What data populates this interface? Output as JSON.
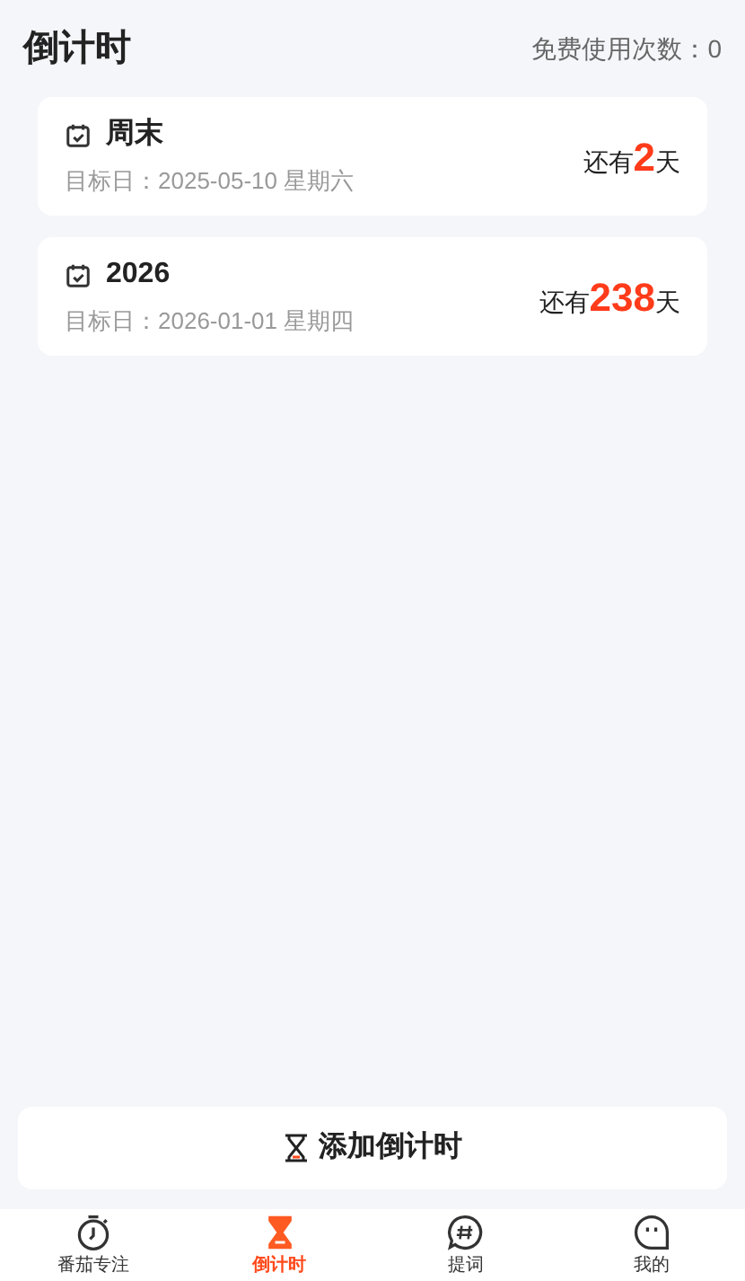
{
  "header": {
    "title": "倒计时",
    "usage": "免费使用次数：0"
  },
  "countdowns": [
    {
      "name": "周末",
      "target": "目标日：2025-05-10 星期六",
      "prefix": "还有",
      "days": "2",
      "suffix": "天"
    },
    {
      "name": "2026",
      "target": "目标日：2026-01-01 星期四",
      "prefix": "还有",
      "days": "238",
      "suffix": "天"
    }
  ],
  "add_button": {
    "label": "添加倒计时"
  },
  "tabs": [
    {
      "kind": "focus",
      "label": "番茄专注",
      "selected": false
    },
    {
      "kind": "countdown",
      "label": "倒计时",
      "selected": true
    },
    {
      "kind": "prompt",
      "label": "提词",
      "selected": false
    },
    {
      "kind": "me",
      "label": "我的",
      "selected": false
    }
  ]
}
